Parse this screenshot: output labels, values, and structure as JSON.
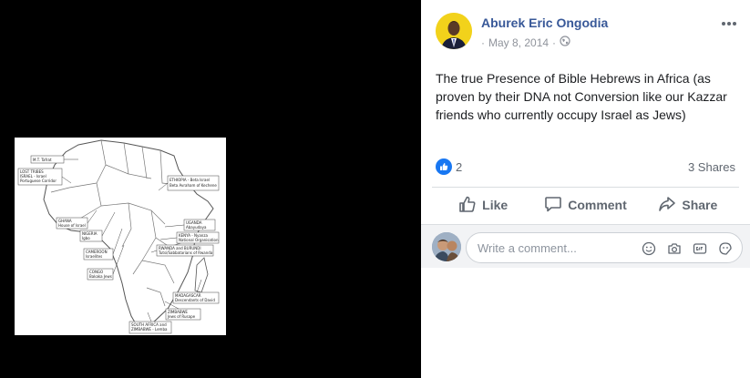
{
  "post": {
    "author": "Aburek Eric Ongodia",
    "date": "May 8, 2014",
    "separator": "·",
    "audience_icon": "globe-icon",
    "text": "The true Presence of Bible Hebrews in Africa (as proven by their DNA not Conversion like our Kazzar friends who currently occupy Israel as Jews)"
  },
  "stats": {
    "reaction_icon": "thumbs-up-icon",
    "reaction_count": "2",
    "shares": "3 Shares"
  },
  "actions": {
    "like": "Like",
    "comment": "Comment",
    "share": "Share"
  },
  "comment_box": {
    "placeholder": "Write a comment...",
    "icons": [
      "emoji-icon",
      "camera-icon",
      "gif-icon",
      "sticker-icon"
    ]
  },
  "photo": {
    "labels": [
      "M.T. Tafrat",
      "LOST TRIBES",
      "ISRAEL - Israel",
      "Portuguese Corridor",
      "ETHIOPIA - Beta Israel",
      "Beta Avraham of Kechene",
      "GHANA",
      "House of Israel",
      "NIGERIA",
      "Igbo",
      "CAMEROON",
      "Israelites",
      "CONGO",
      "Bakaka Jews",
      "UGANDA",
      "Abayudaya",
      "KENYA - Nyanza",
      "National Organisation",
      "RWANDA and BURUNDI",
      "Tutsi/Sabbatarians of Rwanda",
      "MADAGASCAR",
      "Descendants of David",
      "ZIMBABWE",
      "Jews of Rusape",
      "SOUTH AFRICA and",
      "ZIMBABWE - Lemba"
    ]
  },
  "colors": {
    "link_blue": "#385898",
    "like_blue": "#1877f2",
    "text_gray": "#606770"
  }
}
